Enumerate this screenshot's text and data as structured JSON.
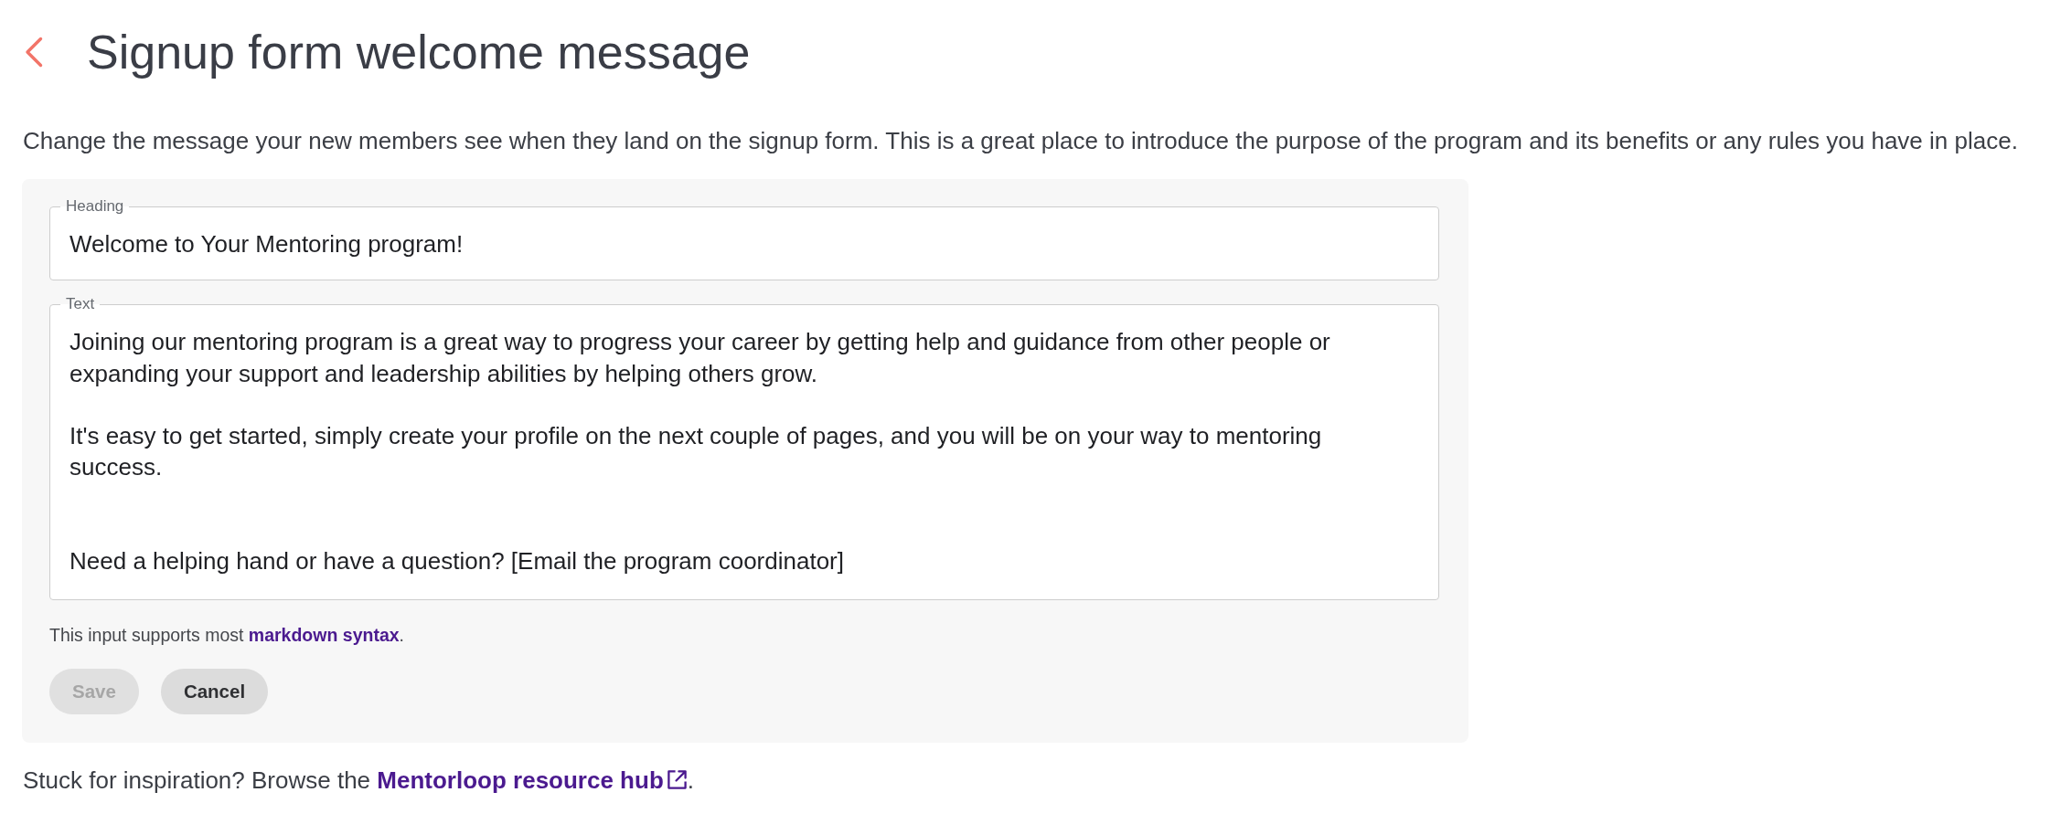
{
  "header": {
    "title": "Signup form welcome message"
  },
  "description": "Change the message your new members see when they land on the signup form. This is a great place to introduce the purpose of the program and its benefits or any rules you have in place.",
  "form": {
    "fields": [
      {
        "kind": "input",
        "label": "Heading",
        "value": "Welcome to Your Mentoring program!"
      },
      {
        "kind": "textarea",
        "label": "Text",
        "value": "Joining our mentoring program is a great way to progress your career by getting help and guidance from other people or expanding your support and leadership abilities by helping others grow.\n\nIt's easy to get started, simply create your profile on the next couple of pages, and you will be on your way to mentoring success.\n\n\nNeed a helping hand or have a question? [Email the program coordinator]"
      }
    ],
    "hint": {
      "text": "This input supports most ",
      "link": "markdown syntax",
      "after": "."
    },
    "buttons": [
      {
        "label": "Save",
        "disabled": true
      },
      {
        "label": "Cancel",
        "disabled": false
      }
    ]
  },
  "footer": {
    "text": "Stuck for inspiration? Browse the ",
    "link": "Mentorloop resource hub",
    "after": "."
  }
}
